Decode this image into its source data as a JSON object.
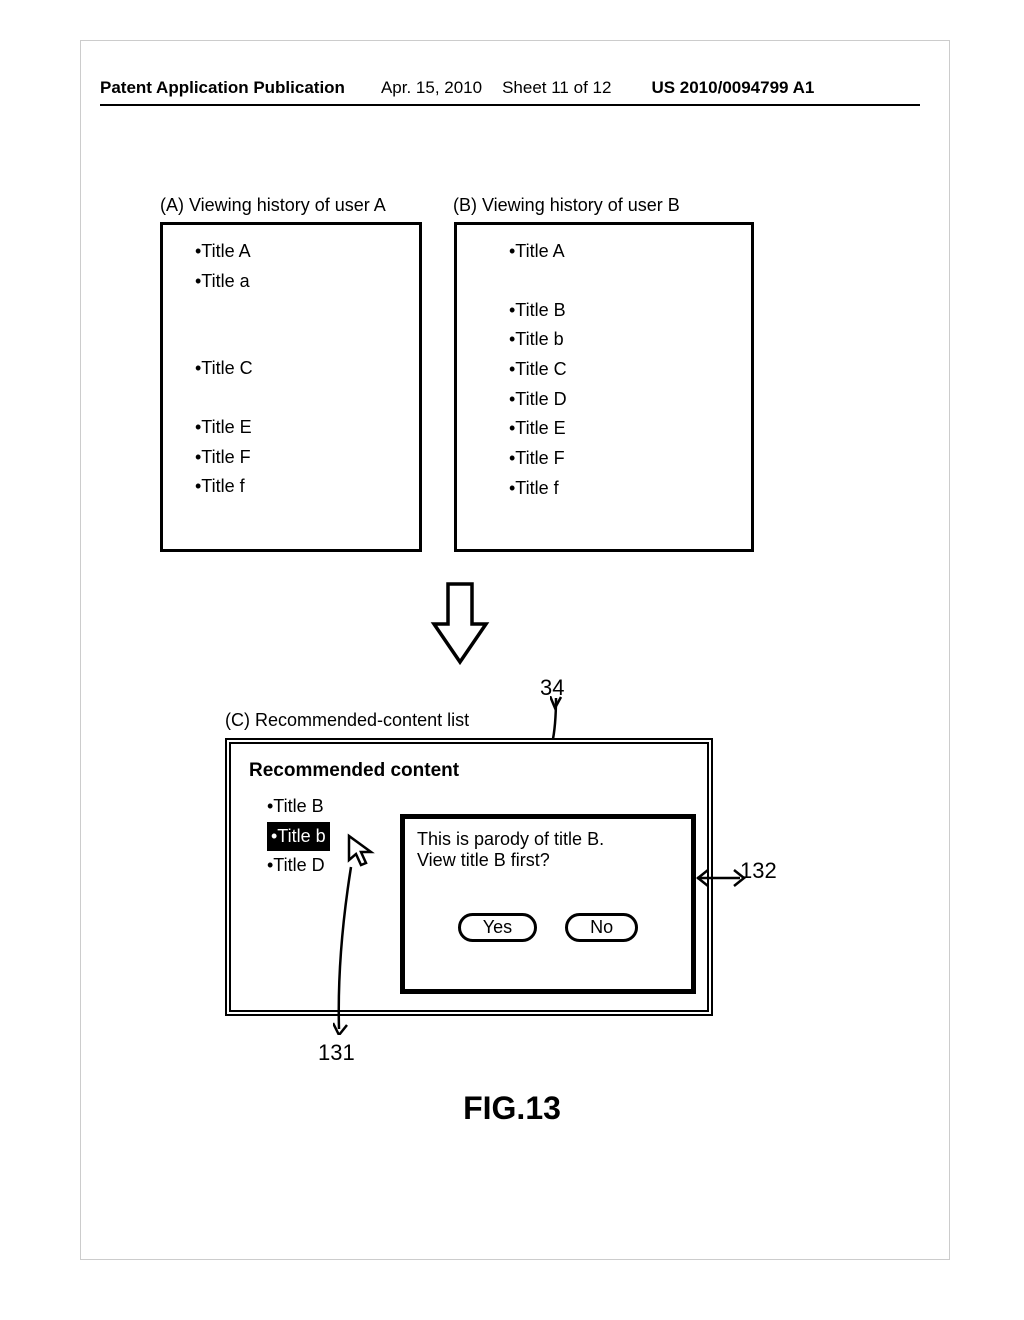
{
  "header": {
    "publication": "Patent Application Publication",
    "date": "Apr. 15, 2010",
    "sheet": "Sheet 11 of 12",
    "patno": "US 2010/0094799 A1"
  },
  "labels": {
    "a": "(A) Viewing history of user A",
    "b": "(B) Viewing history of user B",
    "c": "(C) Recommended-content list"
  },
  "userA": {
    "rows": [
      "Title A",
      "Title a",
      "",
      "",
      "Title C",
      "",
      "Title E",
      "Title F",
      "Title f"
    ]
  },
  "userB": {
    "rows": [
      "Title A",
      "",
      "Title B",
      "Title b",
      "Title C",
      "Title D",
      "Title E",
      "Title F",
      "Title f"
    ]
  },
  "recommended": {
    "title": "Recommended content",
    "rows": [
      "Title B",
      "Title b",
      "Title D"
    ],
    "selected_index": 1
  },
  "popup": {
    "line1": "This is parody of title B.",
    "line2": "View title B first?",
    "yes": "Yes",
    "no": "No"
  },
  "refs": {
    "r34": "34",
    "r131": "131",
    "r132": "132"
  },
  "figure": "FIG.13"
}
